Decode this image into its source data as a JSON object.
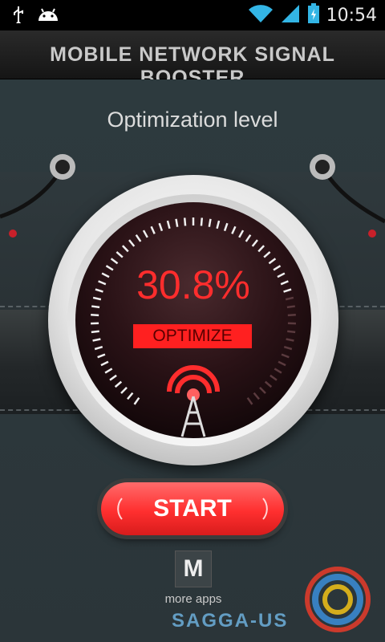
{
  "status_bar": {
    "time": "10:54",
    "icons": [
      "usb-icon",
      "android-icon",
      "wifi-icon",
      "signal-icon",
      "battery-icon"
    ]
  },
  "header": {
    "title": "MOBILE NETWORK SIGNAL BOOSTER"
  },
  "main": {
    "optimization_label": "Optimization level",
    "dial": {
      "percent_text": "30.8%",
      "percent_value": 30.8,
      "optimize_label": "OPTIMIZE"
    },
    "start_button": "START",
    "more_apps": {
      "icon_letter": "M",
      "label": "more apps"
    }
  },
  "watermark": {
    "text": "SAGGA-US"
  },
  "colors": {
    "accent_red": "#ff2d2d",
    "background": "#2a3236"
  }
}
